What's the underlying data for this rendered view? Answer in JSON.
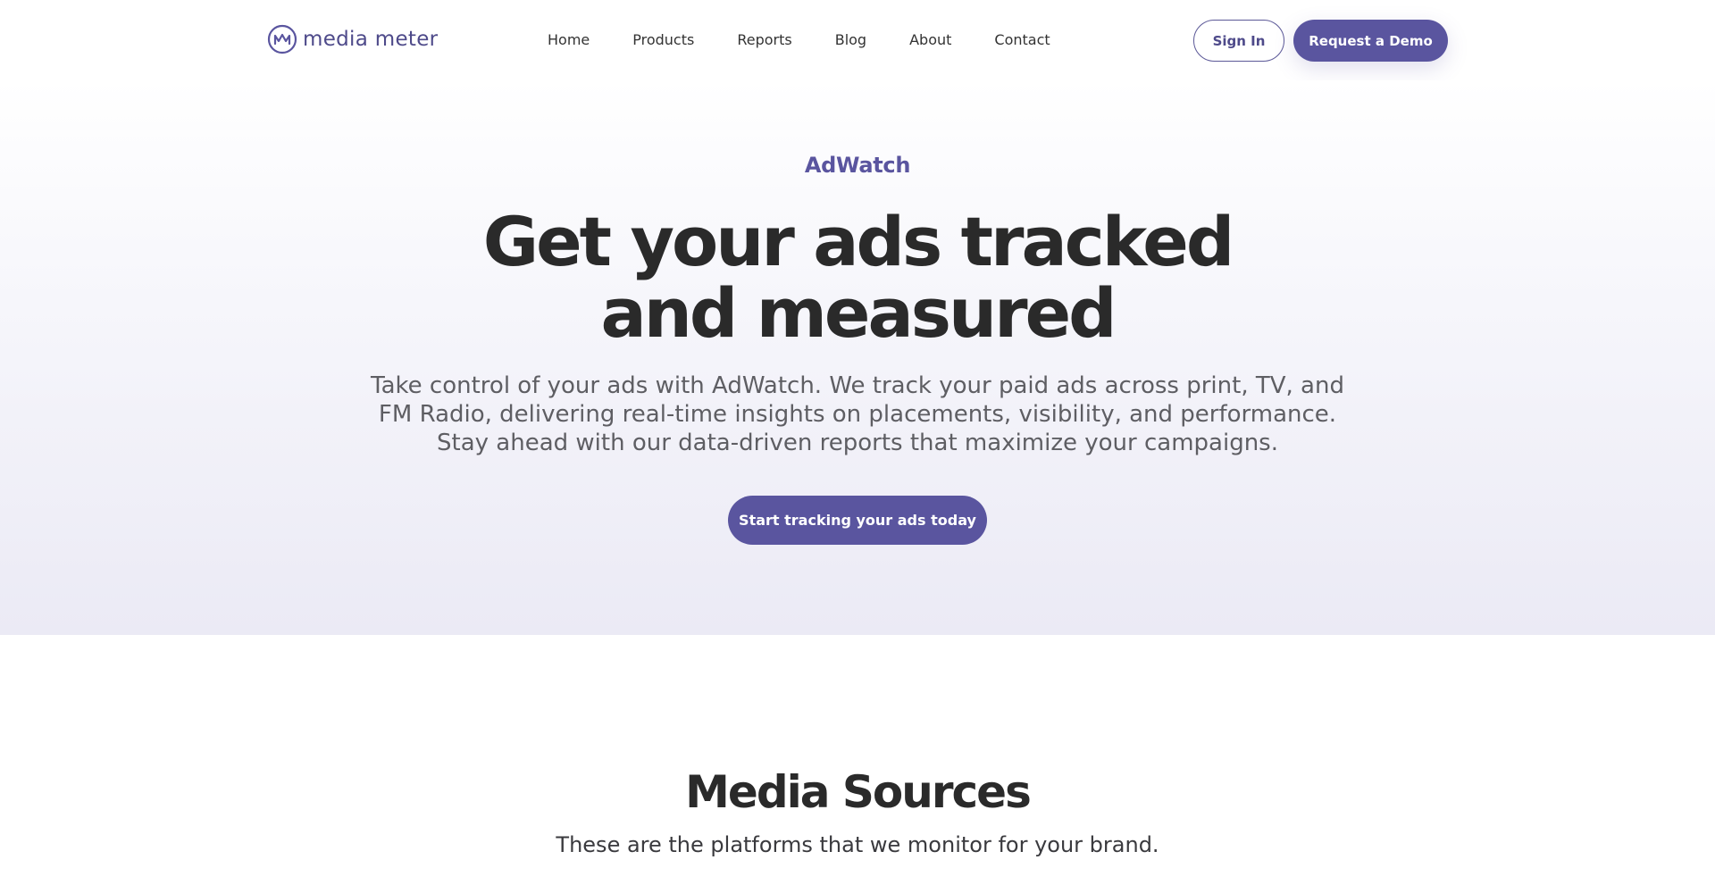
{
  "brand": {
    "name": "media meter",
    "accent_color": "#5a559f",
    "icon": "media-meter-logo-icon"
  },
  "nav": {
    "links": [
      "Home",
      "Products",
      "Reports",
      "Blog",
      "About",
      "Contact"
    ],
    "sign_in_label": "Sign In",
    "demo_label": "Request a Demo"
  },
  "hero": {
    "eyebrow": "AdWatch",
    "headline": "Get your ads tracked and measured",
    "subtext": "Take control of your ads with AdWatch. We track your paid ads across print, TV, and FM Radio, delivering real-time insights on placements, visibility, and performance. Stay ahead with our data-driven reports that maximize your campaigns.",
    "cta_label": "Start tracking your ads today"
  },
  "sources": {
    "title": "Media Sources",
    "subtitle": "These are the platforms that we monitor for your brand."
  }
}
